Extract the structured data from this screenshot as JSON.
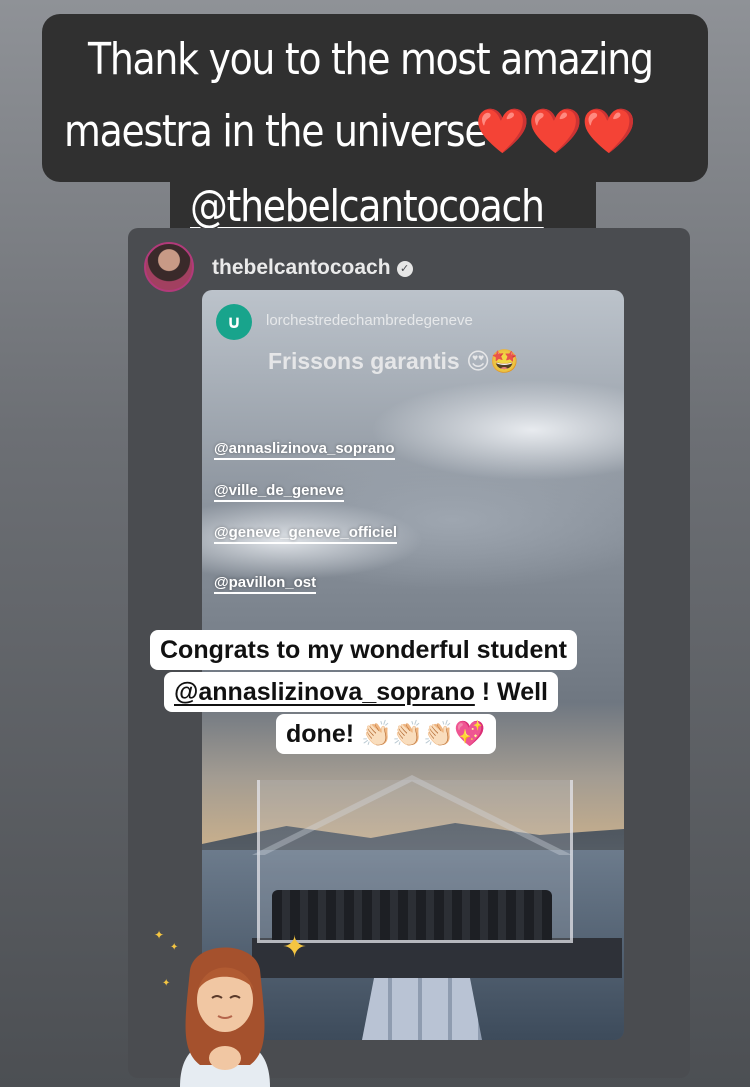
{
  "caption": {
    "line1": "Thank you to the most amazing",
    "line2": "maestra in the universe",
    "line2_hearts": "❤️❤️❤️",
    "line3": "@thebelcantocoach"
  },
  "shared_post": {
    "username": "thebelcantocoach",
    "verified_icon": "verified-badge-icon"
  },
  "inner_story": {
    "account": "lorchestredechambredegeneve",
    "logo_glyph": "∪",
    "caption": "Frissons garantis 😍🤩",
    "mentions": [
      "@annaslizinova_soprano",
      "@ville_de_geneve",
      "@geneve_geneve_officiel",
      "@pavillon_ost"
    ]
  },
  "sticker": {
    "line1": "Congrats to my wonderful student",
    "line2_mention": "@annaslizinova_soprano",
    "line2_rest": " ! Well",
    "line3": "done! 👏🏻👏🏻👏🏻💖"
  },
  "colors": {
    "caption_bg": "#303030",
    "logo_bg": "#18a48c",
    "avatar_ring": "#b23a7a"
  }
}
